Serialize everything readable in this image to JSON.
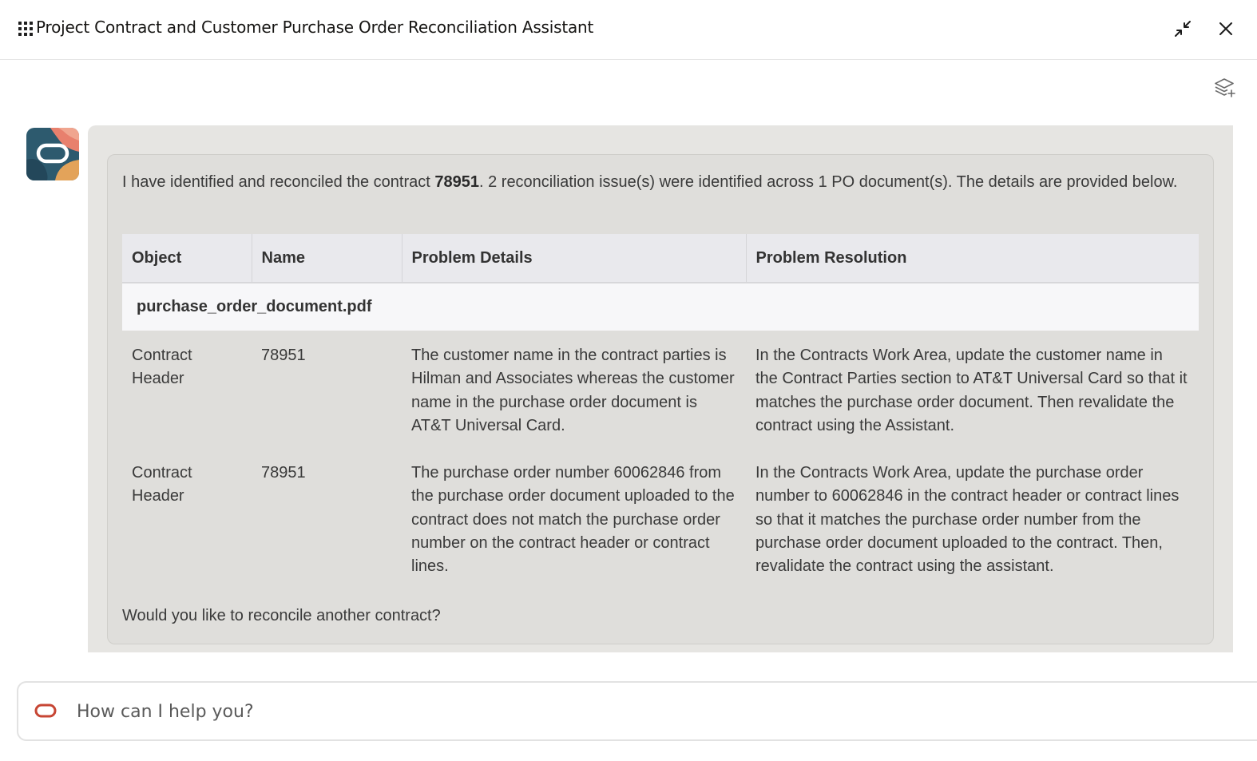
{
  "header": {
    "title": "Project Contract and Customer Purchase Order Reconciliation Assistant",
    "menu_icon": "grid-menu-icon",
    "minimize_icon": "minimize-icon",
    "close_icon": "close-icon"
  },
  "toolbar": {
    "layers_icon": "layers-add-icon"
  },
  "message": {
    "intro_prefix": "I have identified and reconciled the contract ",
    "contract_number": "78951",
    "intro_suffix": ". 2 reconciliation issue(s) were identified across 1 PO document(s). The details are provided below.",
    "table": {
      "headers": [
        "Object",
        "Name",
        "Problem Details",
        "Problem Resolution"
      ],
      "group_label": "purchase_order_document.pdf",
      "rows": [
        {
          "object": "Contract Header",
          "name": "78951",
          "details": "The customer name in the contract parties is Hilman and Associates whereas the customer name in the purchase order document is AT&T Universal Card.",
          "resolution": "In the Contracts Work Area, update the customer name in the Contract Parties section to AT&T Universal Card so that it matches the purchase order document. Then revalidate the contract using the Assistant."
        },
        {
          "object": "Contract Header",
          "name": "78951",
          "details": "The purchase order number 60062846 from the purchase order document uploaded to the contract does not match the purchase order number on the contract header or contract lines.",
          "resolution": "In the Contracts Work Area, update the purchase order number to 60062846 in the contract header or contract lines so that it matches the purchase order number from the purchase order document uploaded to the contract. Then, revalidate the contract using the assistant."
        }
      ]
    },
    "followup": "Would you like to reconcile another contract?"
  },
  "input": {
    "placeholder": "How can I help you?",
    "value": ""
  },
  "colors": {
    "accent": "#c74634",
    "bubble_outer": "#e6e5e2",
    "bubble_inner": "#dfdedb",
    "table_header": "#e9e9ed"
  }
}
